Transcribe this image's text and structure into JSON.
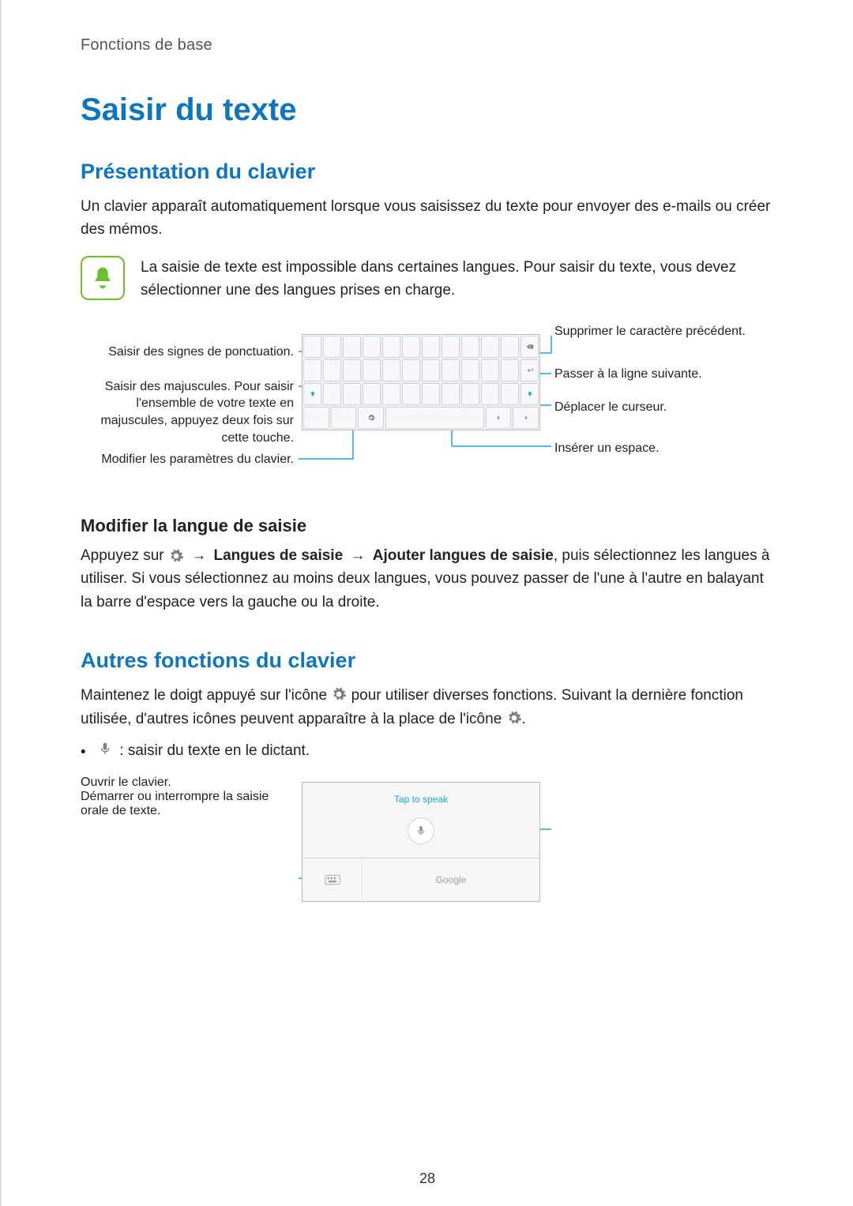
{
  "breadcrumb": "Fonctions de base",
  "title": "Saisir du texte",
  "section1": {
    "heading": "Présentation du clavier",
    "para1": "Un clavier apparaît automatiquement lorsque vous saisissez du texte pour envoyer des e-mails ou créer des mémos.",
    "note": "La saisie de texte est impossible dans certaines langues. Pour saisir du texte, vous devez sélectionner une des langues prises en charge.",
    "labels_left": {
      "punctuation": "Saisir des signes de ponctuation.",
      "shift": "Saisir des majuscules. Pour saisir l'ensemble de votre texte en majuscules, appuyez deux fois sur cette touche.",
      "settings": "Modifier les paramètres du clavier."
    },
    "labels_right": {
      "delete": "Supprimer le caractère précédent.",
      "newline": "Passer à la ligne suivante.",
      "cursor": "Déplacer le curseur.",
      "space": "Insérer un espace."
    },
    "sub1": {
      "heading": "Modifier la langue de saisie",
      "pre": "Appuyez sur ",
      "arrow": "→",
      "bold1": "Langues de saisie",
      "bold2": "Ajouter langues de saisie",
      "post": ", puis sélectionnez les langues à utiliser. Si vous sélectionnez au moins deux langues, vous pouvez passer de l'une à l'autre en balayant la barre d'espace vers la gauche ou la droite."
    }
  },
  "section2": {
    "heading": "Autres fonctions du clavier",
    "para_pre": "Maintenez le doigt appuyé sur l'icône ",
    "para_mid": " pour utiliser diverses fonctions. Suivant la dernière fonction utilisée, d'autres icônes peuvent apparaître à la place de l'icône ",
    "para_end": ".",
    "bullet1": " : saisir du texte en le dictant.",
    "voice_labels": {
      "open_kbd": "Ouvrir le clavier.",
      "start_stop": "Démarrer ou interrompre la saisie orale de texte."
    },
    "voice_panel": {
      "tap": "Tap to speak",
      "brand": "Google"
    }
  },
  "page_number": "28"
}
